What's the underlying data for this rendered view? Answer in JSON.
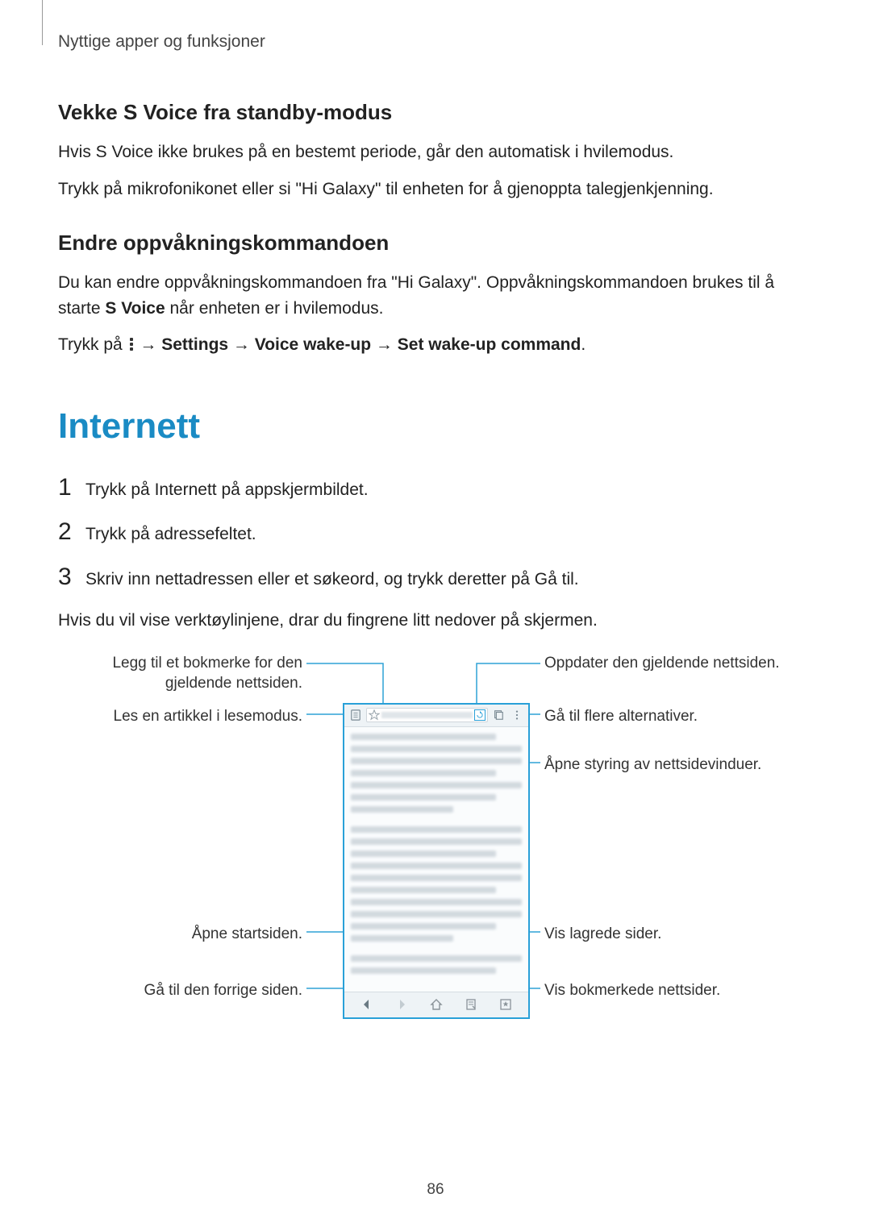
{
  "header": {
    "chapter": "Nyttige apper og funksjoner"
  },
  "section1": {
    "heading": "Vekke S Voice fra standby-modus",
    "p1": "Hvis S Voice ikke brukes på en bestemt periode, går den automatisk i hvilemodus.",
    "p2": "Trykk på mikrofonikonet eller si \"Hi Galaxy\" til enheten for å gjenoppta talegjenkjenning."
  },
  "section2": {
    "heading": "Endre oppvåkningskommandoen",
    "p1_a": "Du kan endre oppvåkningskommandoen fra \"Hi Galaxy\". Oppvåkningskommandoen brukes til å starte ",
    "p1_bold": "S Voice",
    "p1_b": " når enheten er i hvilemodus.",
    "p2_a": "Trykk på ",
    "p2_arrow1": " → ",
    "p2_b1": "Settings",
    "p2_arrow2": " → ",
    "p2_b2": "Voice wake-up",
    "p2_arrow3": " → ",
    "p2_b3": "Set wake-up command",
    "p2_end": "."
  },
  "main": {
    "heading": "Internett"
  },
  "steps": {
    "n1": "1",
    "t1_a": "Trykk på ",
    "t1_b": "Internett",
    "t1_c": " på appskjermbildet.",
    "n2": "2",
    "t2": "Trykk på adressefeltet.",
    "n3": "3",
    "t3_a": "Skriv inn nettadressen eller et søkeord, og trykk deretter på ",
    "t3_b": "Gå til",
    "t3_c": "."
  },
  "afterSteps": "Hvis du vil vise verktøylinjene, drar du fingrene litt nedover på skjermen.",
  "callouts": {
    "bookmarkAdd": "Legg til et bokmerke for den gjeldende nettsiden.",
    "readMode": "Les en artikkel i lesemodus.",
    "homepage": "Åpne startsiden.",
    "back": "Gå til den forrige siden.",
    "refresh": "Oppdater den gjeldende nettsiden.",
    "moreOptions": "Gå til flere alternativer.",
    "windows": "Åpne styring av nettsidevinduer.",
    "saved": "Vis lagrede sider.",
    "bookmarks": "Vis bokmerkede nettsider."
  },
  "icons": {
    "reader": "reader-icon",
    "star": "star-icon",
    "refresh": "refresh-icon",
    "tabs": "tabs-icon",
    "more": "more-icon",
    "backArrow": "back-icon",
    "forwardArrow": "forward-icon",
    "home": "home-icon",
    "savedPages": "saved-pages-icon",
    "bookmark": "bookmark-icon"
  },
  "pageNumber": "86"
}
